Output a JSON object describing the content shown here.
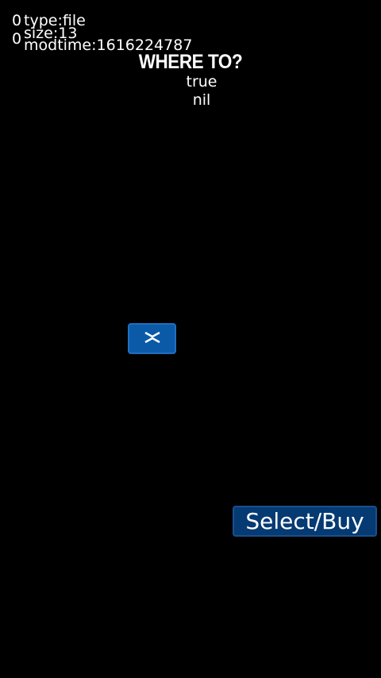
{
  "debug": {
    "counter_1": "0",
    "counter_2": "0",
    "type": "type:file",
    "size": "size:13",
    "modtime": "modtime:1616224787"
  },
  "header": {
    "title": "WHERE TO?"
  },
  "status": {
    "line_1": "true",
    "line_2": "nil"
  },
  "controls": {
    "collapse_icon": "collapse-arrows-icon",
    "select_buy_label": "Select/Buy"
  },
  "colors": {
    "background": "#000000",
    "button_primary": "#0a5aa8",
    "button_dark": "#053a73",
    "text": "#ffffff"
  }
}
